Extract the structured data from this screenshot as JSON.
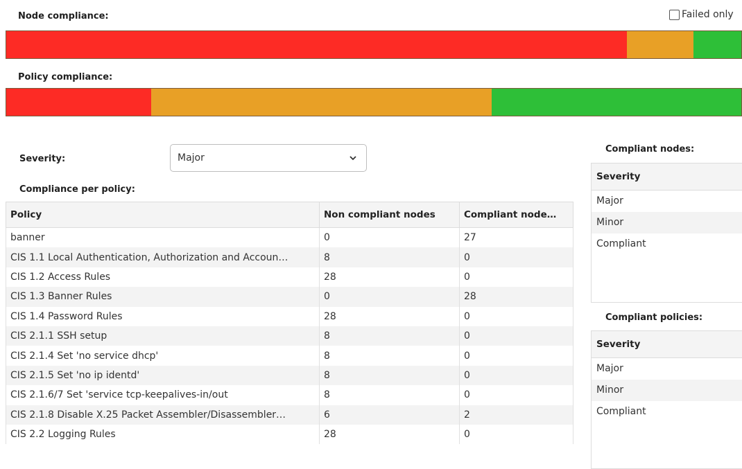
{
  "node_compliance": {
    "label": "Node compliance:",
    "failed_only_label": "Failed only",
    "segments": [
      {
        "status": "non-compliant",
        "color": "#fd2b25",
        "percent": 84.4
      },
      {
        "status": "minor",
        "color": "#e8a026",
        "percent": 9.1
      },
      {
        "status": "compliant",
        "color": "#2ebf38",
        "percent": 6.5
      }
    ]
  },
  "policy_compliance": {
    "label": "Policy compliance:",
    "segments": [
      {
        "status": "non-compliant",
        "color": "#fd2b25",
        "percent": 19.7
      },
      {
        "status": "minor",
        "color": "#e8a026",
        "percent": 46.3
      },
      {
        "status": "compliant",
        "color": "#2ebf38",
        "percent": 34.0
      }
    ]
  },
  "severity_filter": {
    "label": "Severity:",
    "selected": "Major"
  },
  "per_policy": {
    "title": "Compliance per policy:",
    "columns": [
      "Policy",
      "Non compliant nodes",
      "Compliant node…"
    ],
    "rows": [
      [
        "banner",
        "0",
        "27"
      ],
      [
        "CIS 1.1 Local Authentication, Authorization and Accoun…",
        "8",
        "0"
      ],
      [
        "CIS 1.2 Access Rules",
        "28",
        "0"
      ],
      [
        "CIS 1.3 Banner Rules",
        "0",
        "28"
      ],
      [
        "CIS 1.4 Password Rules",
        "28",
        "0"
      ],
      [
        "CIS 2.1.1 SSH setup",
        "8",
        "0"
      ],
      [
        "CIS 2.1.4 Set 'no service dhcp'",
        "8",
        "0"
      ],
      [
        "CIS 2.1.5 Set 'no ip identd'",
        "8",
        "0"
      ],
      [
        "CIS 2.1.6/7 Set 'service tcp-keepalives-in/out",
        "8",
        "0"
      ],
      [
        "CIS 2.1.8 Disable X.25 Packet Assembler/Disassembler…",
        "6",
        "2"
      ],
      [
        "CIS 2.2 Logging Rules",
        "28",
        "0"
      ]
    ]
  },
  "compliant_nodes": {
    "title": "Compliant nodes:",
    "header": "Severity",
    "rows": [
      "Major",
      "Minor",
      "Compliant"
    ]
  },
  "compliant_policies": {
    "title": "Compliant policies:",
    "header": "Severity",
    "rows": [
      "Major",
      "Minor",
      "Compliant"
    ]
  }
}
